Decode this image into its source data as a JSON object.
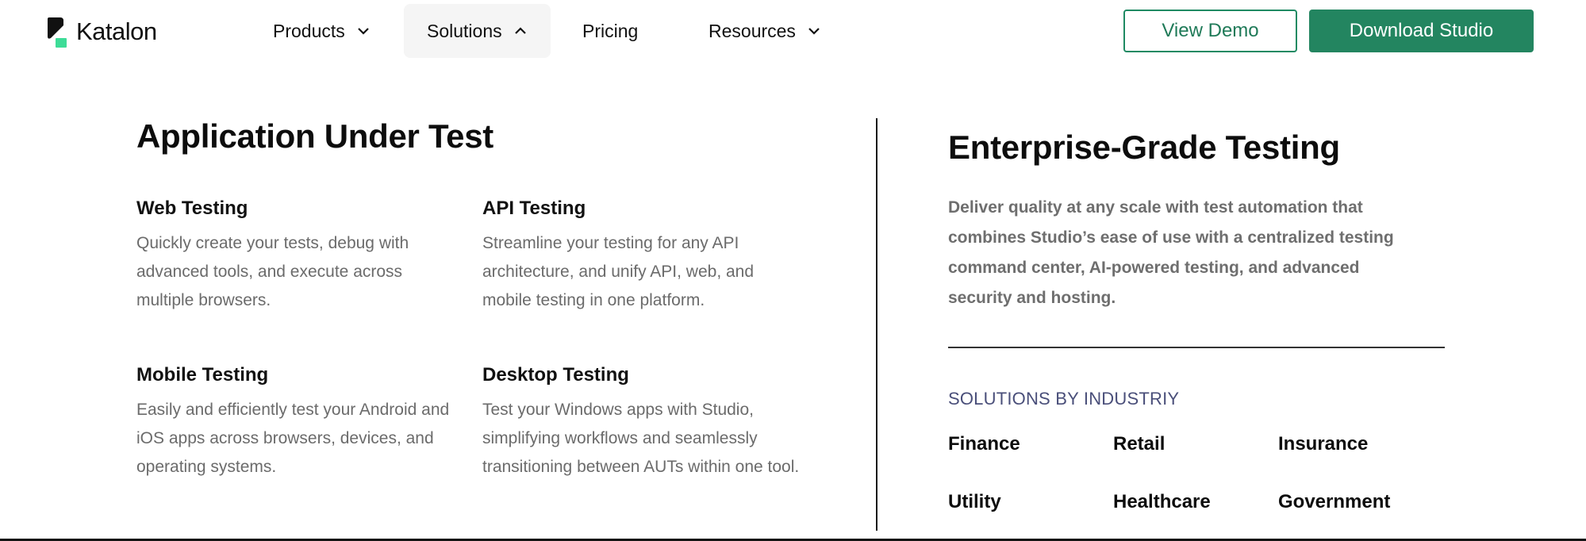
{
  "brand": {
    "name": "Katalon",
    "accent": "#238560",
    "logo_green": "#3ddc97"
  },
  "nav": {
    "items": [
      {
        "label": "Products",
        "icon": "chevron-down-icon"
      },
      {
        "label": "Solutions",
        "icon": "chevron-up-icon"
      },
      {
        "label": "Pricing"
      },
      {
        "label": "Resources",
        "icon": "chevron-down-icon"
      }
    ]
  },
  "actions": {
    "view_demo": "View Demo",
    "download_studio": "Download Studio"
  },
  "aut": {
    "title": "Application Under Test",
    "cards": [
      {
        "title": "Web Testing",
        "desc": "Quickly create your tests, debug with advanced tools, and execute across multiple browsers."
      },
      {
        "title": "API Testing",
        "desc": "Streamline your testing for any API architecture, and unify API, web, and mobile testing in one platform."
      },
      {
        "title": "Mobile Testing",
        "desc": "Easily and efficiently test your Android and iOS apps across browsers, devices, and operating systems."
      },
      {
        "title": "Desktop Testing",
        "desc": "Test your Windows apps with Studio, simplifying workflows and seamlessly transitioning between AUTs within one tool."
      }
    ]
  },
  "enterprise": {
    "title": "Enterprise-Grade Testing",
    "desc": "Deliver quality at any scale with test automation that combines Studio’s ease of use with a centralized testing command center, AI-powered testing, and advanced security and hosting.",
    "industry_label": "SOLUTIONS BY INDUSTRIY",
    "industries": [
      "Finance",
      "Retail",
      "Insurance",
      "Utility",
      "Healthcare",
      "Government"
    ]
  }
}
